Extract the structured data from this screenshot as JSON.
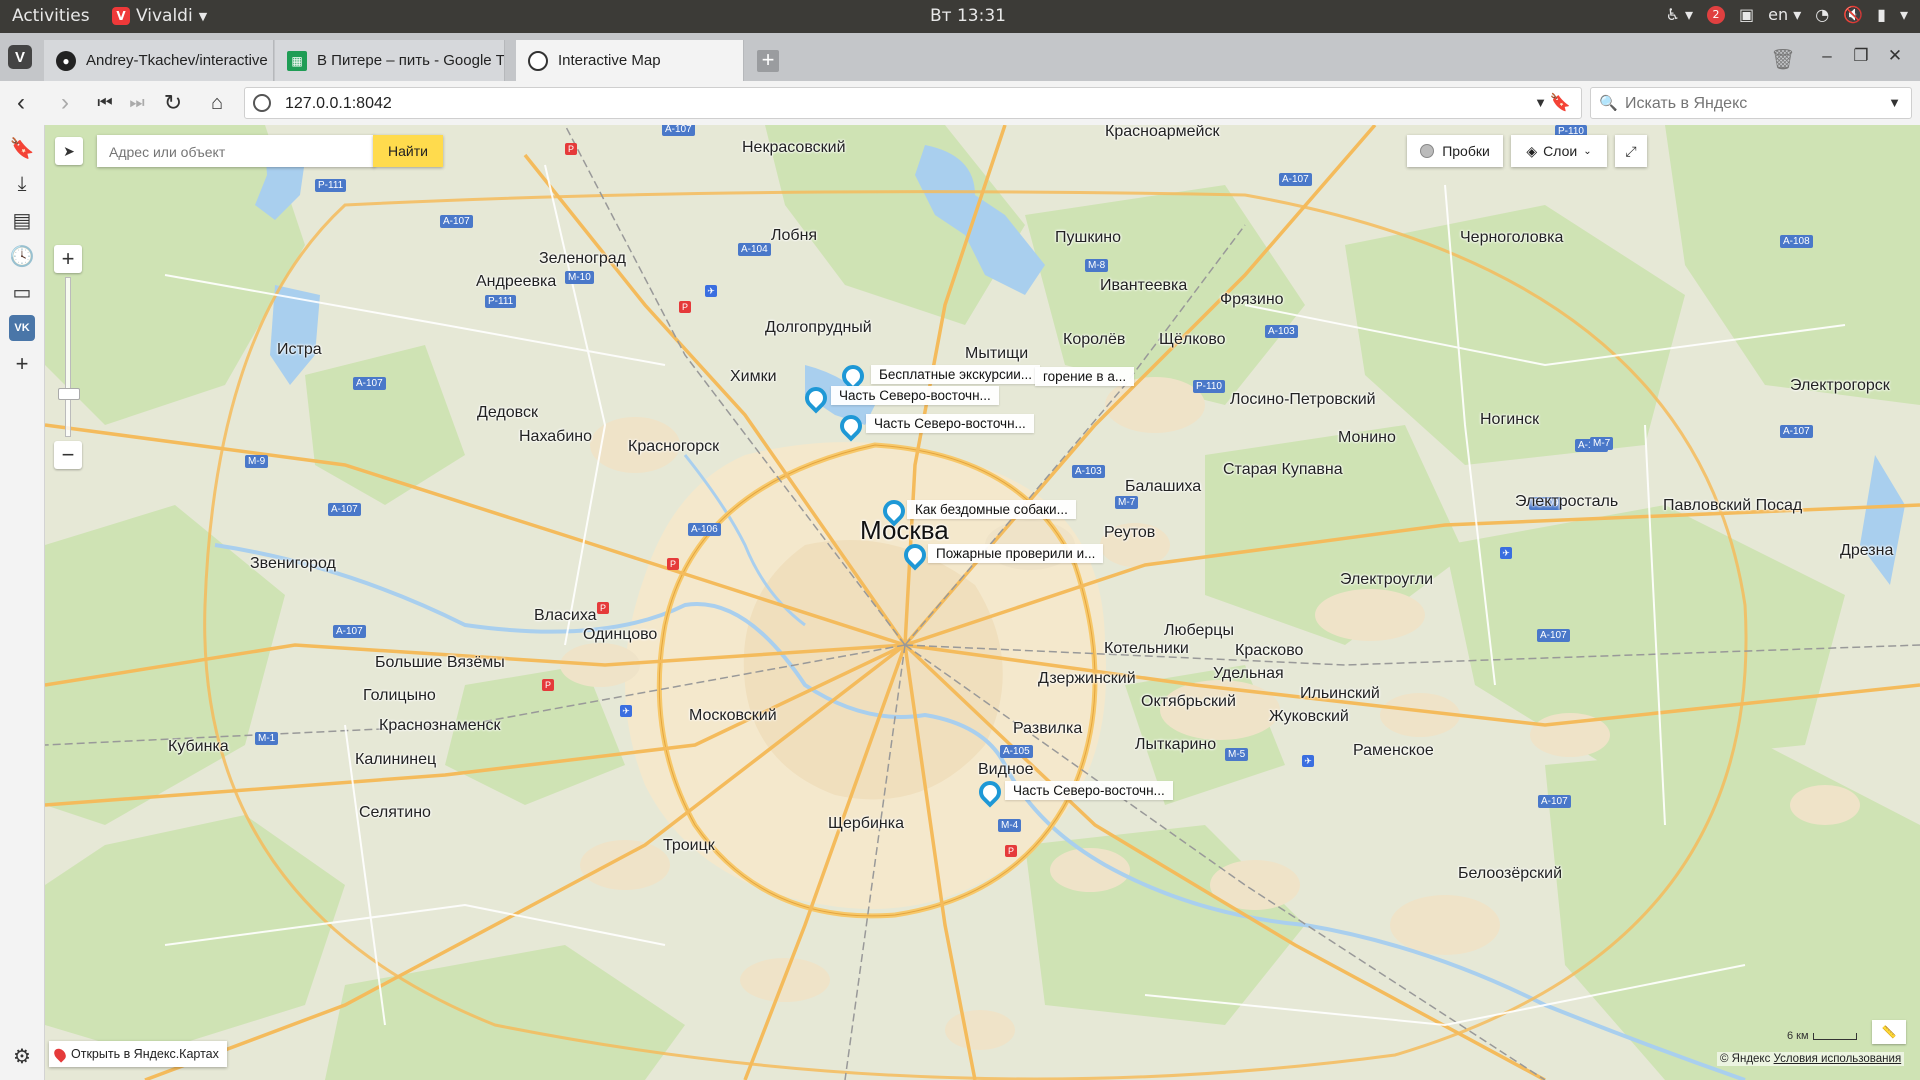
{
  "topbar": {
    "activities": "Activities",
    "app_name": "Vivaldi",
    "clock": "Вт 13:31",
    "language": "en",
    "notification_count": "2"
  },
  "tabs": [
    {
      "title": "Andrey-Tkachev/interactive",
      "icon": "github-icon"
    },
    {
      "title": "В Питере – пить - Google Та",
      "icon": "sheets-icon"
    },
    {
      "title": "Interactive Map",
      "icon": "globe-icon",
      "active": true
    }
  ],
  "address": {
    "url": "127.0.0.1:8042",
    "search_placeholder": "Искать в Яндекс"
  },
  "map": {
    "search_placeholder": "Адрес или объект",
    "find_button": "Найти",
    "traffic_button": "Пробки",
    "layers_button": "Слои",
    "open_in_yandex": "Открыть в Яндекс.Картах",
    "scale": "6 км",
    "copyright": "© Яндекс",
    "terms": "Условия использования",
    "placemarks": [
      "Бесплатные экскурсии...",
      "горение в а...",
      "Часть Северо-восточн...",
      "Часть Северо-восточн...",
      "Как бездомные собаки...",
      "Пожарные проверили и...",
      "Часть Северо-восточн..."
    ],
    "labels": {
      "moscow": "Москва",
      "krasnoarmeysk": "Красноармейск",
      "nekrasovsky": "Некрасовский",
      "lobnya": "Лобня",
      "pushkino": "Пушкино",
      "ivanteevka": "Ивантеевка",
      "fryazino": "Фрязино",
      "chernogolovka": "Черноголовка",
      "zelenograd": "Зеленоград",
      "andreevka": "Андреевка",
      "dolgoprudny": "Долгопрудный",
      "mytishchi": "Мытищи",
      "korolev": "Королёв",
      "shchelkovo": "Щёлково",
      "khimki": "Химки",
      "istra": "Истра",
      "dedovsk": "Дедовск",
      "nakhabino": "Нахабино",
      "krasnogorsk": "Красногорск",
      "losino": "Лосино-Петровский",
      "elektrogorsk": "Электрогорск",
      "noginsk": "Ногинск",
      "monino": "Монино",
      "staraya_kupavna": "Старая Купавна",
      "balashikha": "Балашиха",
      "reutov": "Реутов",
      "elektrostal": "Электросталь",
      "pavlovsky_posad": "Павловский Посад",
      "dresna": "Дрезна",
      "zvenigorod": "Звенигород",
      "elektrougli": "Электроугли",
      "vlasikha": "Власиха",
      "odintsovo": "Одинцово",
      "lyubertsy": "Люберцы",
      "kotelniki": "Котельники",
      "kraskovo": "Красково",
      "bolshie_vyazemy": "Большие Вязёмы",
      "golitsyno": "Голицыно",
      "dzerzhinsky": "Дзержинский",
      "udelnaya": "Удельная",
      "ilinsky": "Ильинский",
      "kubinka": "Кубинка",
      "krasnoznamensk": "Краснознаменск",
      "moskovsky": "Московский",
      "oktyabrsky": "Октябрьский",
      "zhukovsky": "Жуковский",
      "razvilka": "Развилка",
      "lytkarino": "Лыткарино",
      "ramenskoe": "Раменское",
      "kalininets": "Калининец",
      "vidnoe": "Видное",
      "selyatino": "Селятино",
      "shcherbinka": "Щербинка",
      "troitsk": "Троицк",
      "beloozersky": "Белоозёрский"
    }
  }
}
